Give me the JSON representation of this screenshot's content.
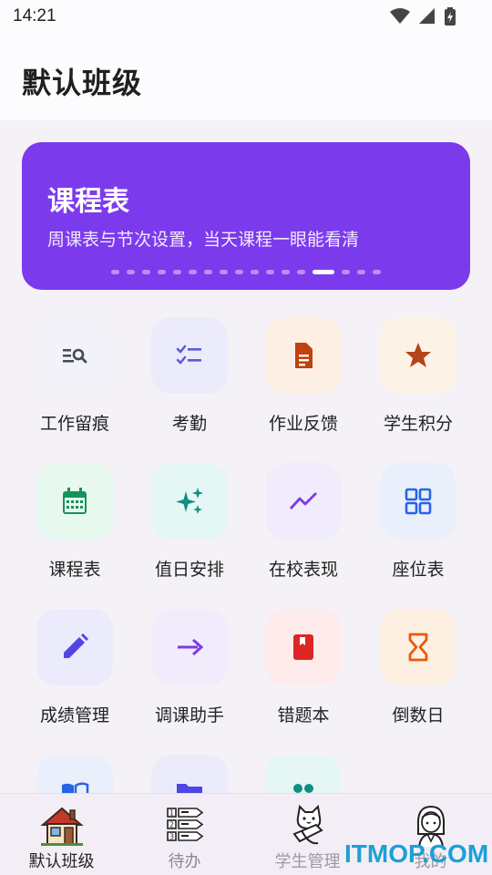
{
  "status": {
    "time": "14:21"
  },
  "header": {
    "title": "默认班级"
  },
  "banner": {
    "title": "课程表",
    "subtitle": "周课表与节次设置，当天课程一眼能看清",
    "page_count": 17,
    "active_index": 13,
    "color": "#7c3aed"
  },
  "grid": [
    {
      "label": "工作留痕",
      "icon": "search-list-icon",
      "bg": "#f3f2f8",
      "fg": "#3f4a5a"
    },
    {
      "label": "考勤",
      "icon": "checklist-icon",
      "bg": "#ecebfc",
      "fg": "#5b5bd6"
    },
    {
      "label": "作业反馈",
      "icon": "document-icon",
      "bg": "#fdefe4",
      "fg": "#c2410c"
    },
    {
      "label": "学生积分",
      "icon": "star-icon",
      "bg": "#fdf2e6",
      "fg": "#b4441a"
    },
    {
      "label": "课程表",
      "icon": "calendar-icon",
      "bg": "#e7f8ee",
      "fg": "#15935a"
    },
    {
      "label": "值日安排",
      "icon": "sparkle-icon",
      "bg": "#e4f7f4",
      "fg": "#0f8f7f"
    },
    {
      "label": "在校表现",
      "icon": "trend-icon",
      "bg": "#f1ecfb",
      "fg": "#7c3aed"
    },
    {
      "label": "座位表",
      "icon": "grid-icon",
      "bg": "#eaf0fb",
      "fg": "#2563eb"
    },
    {
      "label": "成绩管理",
      "icon": "pencil-icon",
      "bg": "#ecebfb",
      "fg": "#4f46e5"
    },
    {
      "label": "调课助手",
      "icon": "arrow-right-icon",
      "bg": "#f1ecfb",
      "fg": "#7c3aed"
    },
    {
      "label": "错题本",
      "icon": "book-icon",
      "bg": "#fdeceb",
      "fg": "#dc2626"
    },
    {
      "label": "倒数日",
      "icon": "hourglass-icon",
      "bg": "#fdf0e2",
      "fg": "#ea580c"
    },
    {
      "label": "",
      "icon": "open-book-icon",
      "bg": "#eaf0fb",
      "fg": "#2563eb"
    },
    {
      "label": "",
      "icon": "folder-icon",
      "bg": "#ecebfc",
      "fg": "#4f46e5"
    },
    {
      "label": "",
      "icon": "group-icon",
      "bg": "#e4f7f4",
      "fg": "#0f8f7f"
    }
  ],
  "bottom_nav": [
    {
      "label": "默认班级",
      "icon": "house-icon",
      "active": true
    },
    {
      "label": "待办",
      "icon": "todo-list-icon",
      "active": false
    },
    {
      "label": "学生管理",
      "icon": "cat-student-icon",
      "active": false
    },
    {
      "label": "我的",
      "icon": "avatar-icon",
      "active": false
    }
  ],
  "watermark": "ITMOP.COM"
}
